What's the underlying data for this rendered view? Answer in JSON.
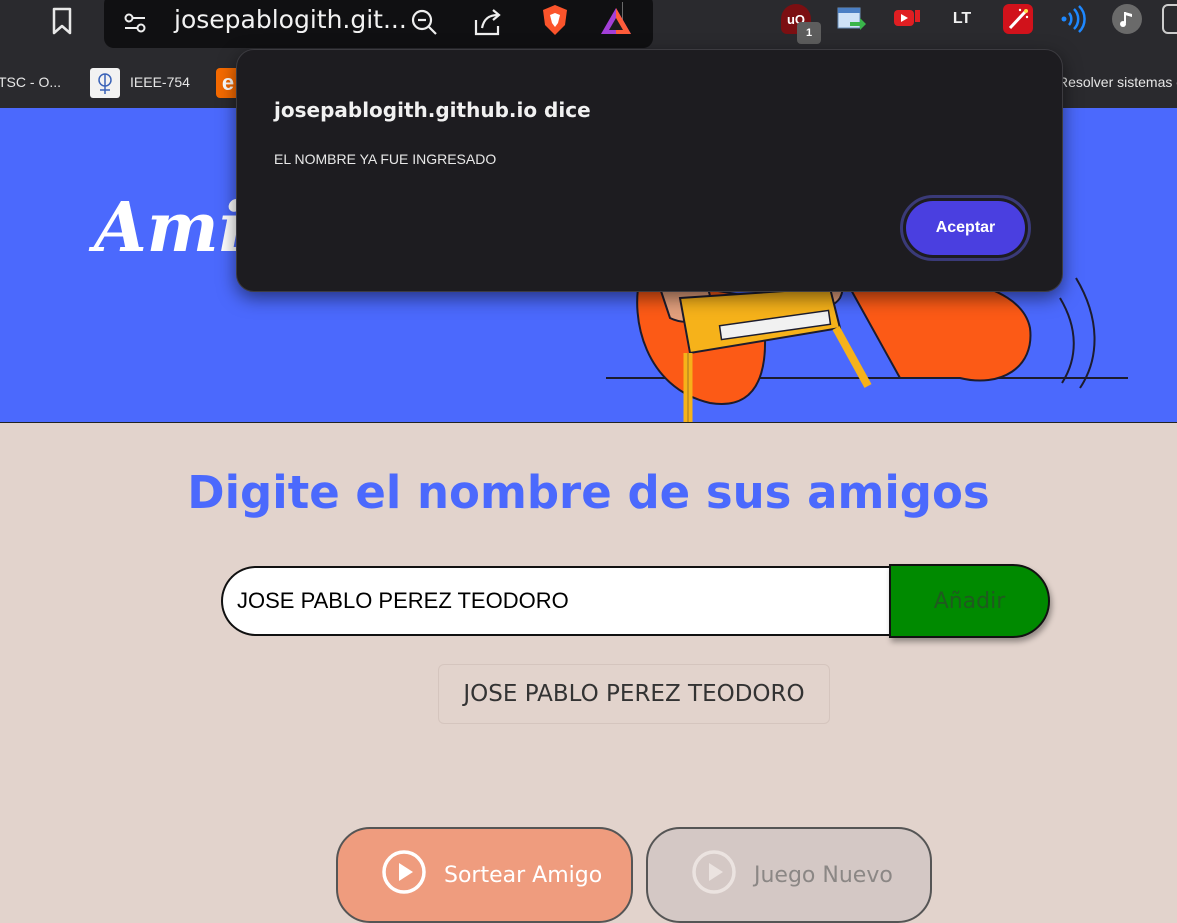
{
  "browser": {
    "url_display": "josepablogith.git...",
    "extension_badge": "1",
    "bookmarks": [
      {
        "label": "TSC - O..."
      },
      {
        "label": "IEEE-754"
      },
      {
        "label": "e"
      },
      {
        "label": "Resolver sistemas d"
      }
    ]
  },
  "hero": {
    "title": "Amig"
  },
  "main": {
    "title": "Digite el nombre de sus amigos",
    "input_value": "JOSE PABLO PEREZ TEODORO",
    "add_label": "Añadir",
    "friends": [
      "JOSE PABLO PEREZ TEODORO"
    ],
    "draw_label": "Sortear Amigo",
    "new_game_label": "Juego Nuevo"
  },
  "dialog": {
    "title": "josepablogith.github.io dice",
    "message": "EL NOMBRE YA FUE INGRESADO",
    "ok_label": "Aceptar"
  },
  "colors": {
    "hero_bg": "#4b69fd",
    "page_bg": "#e2d3cc",
    "add_button": "#008a00",
    "draw_button": "#ef9c7e",
    "new_game_button": "#d4c8c5",
    "dialog_button": "#4a3fe0"
  }
}
